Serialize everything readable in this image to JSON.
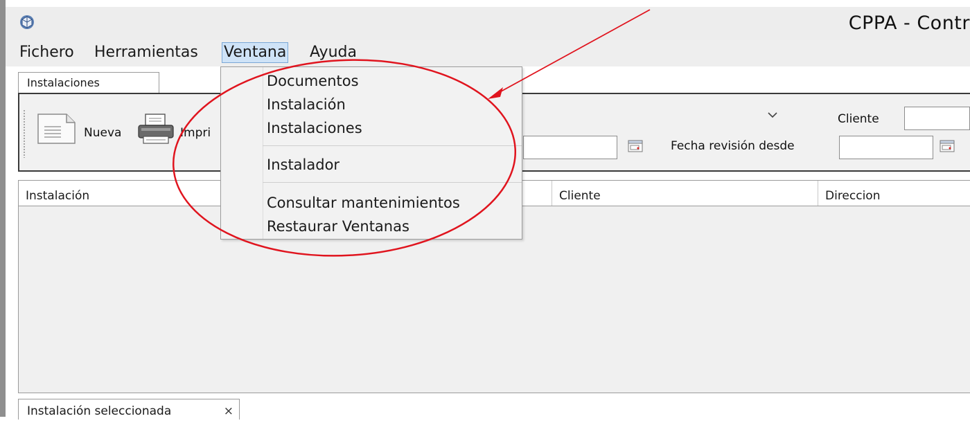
{
  "window": {
    "title": "CPPA - Contr"
  },
  "menubar": {
    "items": [
      {
        "label": "Fichero"
      },
      {
        "label": "Herramientas"
      },
      {
        "label": "Ventana"
      },
      {
        "label": "Ayuda"
      }
    ],
    "active": "Ventana"
  },
  "ventana_menu": {
    "items": [
      {
        "label": "Documentos"
      },
      {
        "label": "Instalación"
      },
      {
        "label": "Instalaciones"
      },
      {
        "label": "Instalador"
      },
      {
        "label": "Consultar mantenimientos"
      },
      {
        "label": "Restaurar Ventanas"
      }
    ]
  },
  "main_tab": {
    "label": "Instalaciones"
  },
  "toolbar": {
    "new_label": "Nueva",
    "print_label": "Impri"
  },
  "filters": {
    "cliente_label": "Cliente",
    "fecha_revision_label": "Fecha revisión desde",
    "cliente_value": "",
    "fecha_value": ""
  },
  "table": {
    "columns": [
      {
        "label": "Instalación"
      },
      {
        "label": "Cliente"
      },
      {
        "label": "Direccion"
      }
    ],
    "rows": []
  },
  "bottom_tab": {
    "label": "Instalación seleccionada",
    "close": "×"
  },
  "annotation": {
    "color": "#e0141e"
  }
}
